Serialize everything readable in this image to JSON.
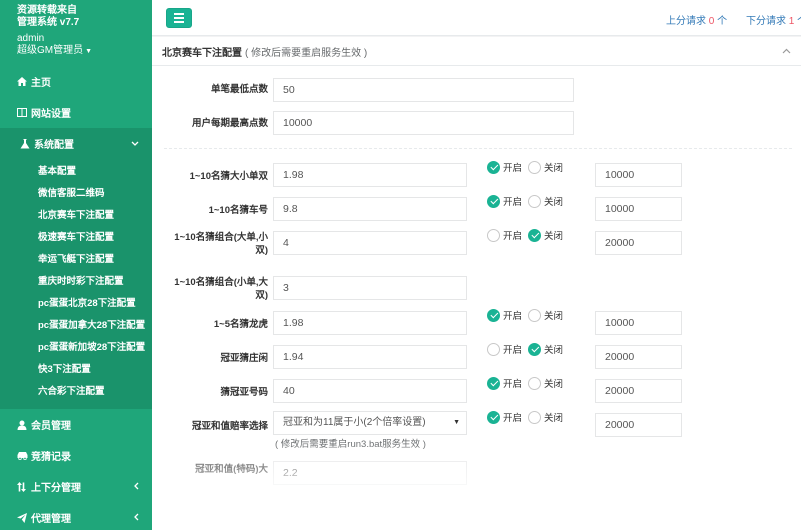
{
  "app": {
    "brand_line1": "资源转载来自",
    "brand_line2": "管理系统 v7.7",
    "username": "admin",
    "role": "超级GM管理员"
  },
  "sidebar": {
    "items_top": [
      {
        "label": "主页",
        "icon": "home-icon"
      },
      {
        "label": "网站设置",
        "icon": "columns-icon"
      },
      {
        "label": "系统配置",
        "icon": "flask-icon"
      }
    ],
    "sub_items": [
      "基本配置",
      "微信客服二维码",
      "北京赛车下注配置",
      "极速赛车下注配置",
      "幸运飞艇下注配置",
      "重庆时时彩下注配置",
      "pc蛋蛋北京28下注配置",
      "pc蛋蛋加拿大28下注配置",
      "pc蛋蛋新加坡28下注配置",
      "快3下注配置",
      "六合彩下注配置"
    ],
    "items_bottom": [
      {
        "label": "会员管理",
        "icon": "user-icon"
      },
      {
        "label": "竞猜记录",
        "icon": "car-icon"
      },
      {
        "label": "上下分管理",
        "icon": "arrows-icon"
      },
      {
        "label": "代理管理",
        "icon": "send-icon"
      }
    ]
  },
  "topbar": {
    "up_label": "上分请求",
    "up_count": "0",
    "up_unit": "个",
    "down_label": "下分请求",
    "down_count": "1",
    "down_unit": "个"
  },
  "panel": {
    "title": "北京赛车下注配置",
    "hint": "( 修改后需要重启服务生效 )"
  },
  "basic": {
    "min_label": "单笔最低点数",
    "min_value": "50",
    "max_label": "用户每期最高点数",
    "max_value": "10000"
  },
  "radio_labels": {
    "on": "开启",
    "off": "关闭"
  },
  "rows": [
    {
      "label": "1~10名猜大小单双",
      "odds": "1.98",
      "enabled": true,
      "limit": "10000"
    },
    {
      "label": "1~10名猜车号",
      "odds": "9.8",
      "enabled": true,
      "limit": "10000"
    },
    {
      "label": "1~10名猜组合(大单,小双)",
      "odds": "4",
      "enabled": false,
      "limit": "20000"
    },
    {
      "label": "1~10名猜组合(小单,大双)",
      "odds": "3"
    },
    {
      "label": "1~5名猜龙虎",
      "odds": "1.98",
      "enabled": true,
      "limit": "10000"
    },
    {
      "label": "冠亚猜庄闲",
      "odds": "1.94",
      "enabled": false,
      "limit": "20000"
    },
    {
      "label": "猜冠亚号码",
      "odds": "40",
      "enabled": true,
      "limit": "20000"
    },
    {
      "label": "冠亚和值赔率选择",
      "select": "冠亚和为11属于小(2个倍率设置)",
      "hint": "( 修改后需要重启run3.bat服务生效 )",
      "enabled": true,
      "limit": "20000"
    },
    {
      "label": "冠亚和值(特码)大",
      "odds": "2.2"
    }
  ]
}
